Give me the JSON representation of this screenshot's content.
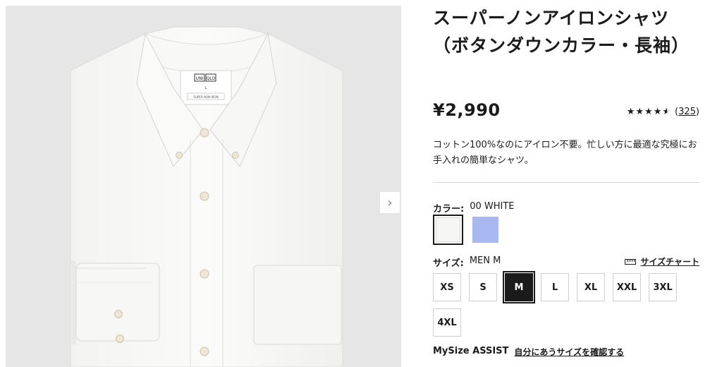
{
  "product": {
    "title": "スーパーノンアイロンシャツ（ボタンダウンカラー・長袖）",
    "price": "¥2,990",
    "rating_stars": "★★★★",
    "rating_half_star": "★",
    "rating_value": 4.5,
    "rating_count": "325",
    "description": "コットン100%なのにアイロン不要。忙しい方に最適な究極にお手入れの簡単なシャツ。"
  },
  "gallery": {
    "next_arrow": "›",
    "shirt_label_brand_top": "UNI",
    "shirt_label_brand_bottom": "QLO",
    "shirt_label_size": "L",
    "shirt_label_tag": "SUPER NON-IRON"
  },
  "color": {
    "label": "カラー:",
    "selected_value": "00 WHITE",
    "swatches": [
      {
        "name": "white",
        "hex": "#f6f6f4"
      },
      {
        "name": "blue",
        "hex": "#a9b9ef"
      }
    ]
  },
  "size": {
    "label": "サイズ:",
    "selected_value": "MEN M",
    "chart_link": "サイズチャート",
    "options": [
      "XS",
      "S",
      "M",
      "L",
      "XL",
      "XXL",
      "3XL",
      "4XL"
    ],
    "selected": "M"
  },
  "mysize": {
    "label": "MySize ASSIST",
    "link": "自分にあうサイズを確認する"
  }
}
